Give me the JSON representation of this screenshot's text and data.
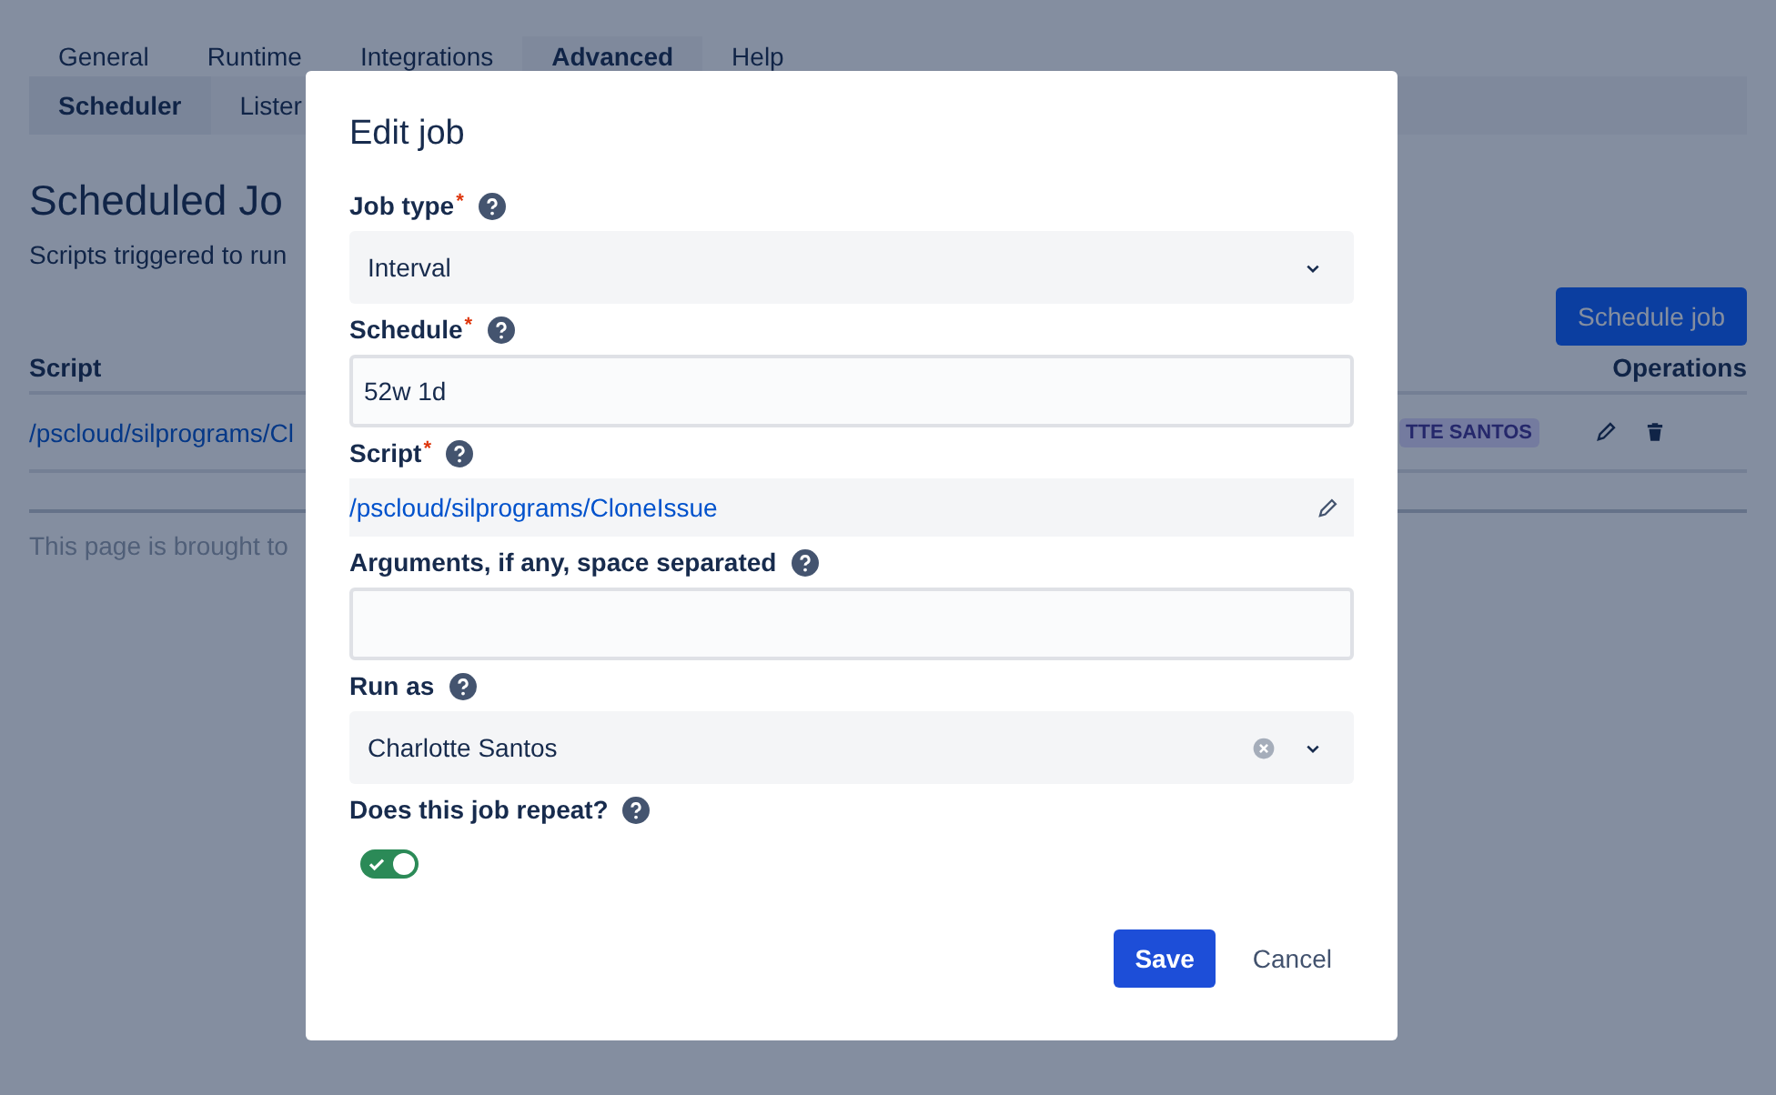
{
  "tabs": [
    {
      "label": "General",
      "selected": false
    },
    {
      "label": "Runtime",
      "selected": false
    },
    {
      "label": "Integrations",
      "selected": false
    },
    {
      "label": "Advanced",
      "selected": true
    },
    {
      "label": "Help",
      "selected": false
    }
  ],
  "subtabs": [
    {
      "label": "Scheduler",
      "selected": true
    },
    {
      "label": "Lister",
      "selected": false
    }
  ],
  "page": {
    "title": "Scheduled Jo",
    "subtitle": "Scripts triggered to run",
    "primary_button": "Schedule job",
    "footer": "This page is brought to"
  },
  "table": {
    "columns": [
      "Script",
      "Operations"
    ],
    "rows": [
      {
        "script": "/pscloud/silprograms/Cl",
        "user_badge": "TTE SANTOS"
      }
    ]
  },
  "dialog": {
    "title": "Edit job",
    "fields": [
      {
        "kind": "select",
        "label": "Job type",
        "required_mark": "*",
        "value": "Interval",
        "clearable": false
      },
      {
        "kind": "text",
        "label": "Schedule",
        "required_mark": "*",
        "value": "52w 1d"
      },
      {
        "kind": "script",
        "label": "Script",
        "required_mark": "*",
        "value": "/pscloud/silprograms/CloneIssue"
      },
      {
        "kind": "text",
        "label": "Arguments, if any, space separated"
      },
      {
        "kind": "select",
        "label": "Run as",
        "value": "Charlotte Santos",
        "clearable": true
      },
      {
        "kind": "toggle",
        "label": "Does this job repeat?",
        "on": true
      }
    ],
    "buttons": [
      {
        "label": "Save",
        "kind": "primary"
      },
      {
        "label": "Cancel",
        "kind": "subtle"
      }
    ]
  }
}
